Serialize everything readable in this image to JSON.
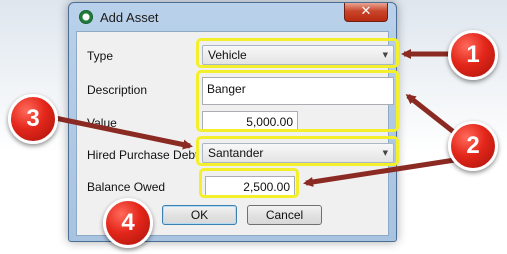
{
  "window": {
    "title": "Add Asset",
    "close_glyph": "✕"
  },
  "form": {
    "type_label": "Type",
    "type_value": "Vehicle",
    "description_label": "Description",
    "description_value": "Banger",
    "value_label": "Value",
    "value_value": "5,000.00",
    "hp_debt_label": "Hired Purchase Debt",
    "hp_debt_value": "Santander",
    "balance_label": "Balance Owed",
    "balance_value": "2,500.00"
  },
  "buttons": {
    "ok": "OK",
    "cancel": "Cancel"
  },
  "callouts": [
    "1",
    "2",
    "3",
    "4"
  ],
  "colors": {
    "highlight": "#f3ef2b",
    "callout": "#e3261a",
    "arrow": "#8b2a22"
  }
}
